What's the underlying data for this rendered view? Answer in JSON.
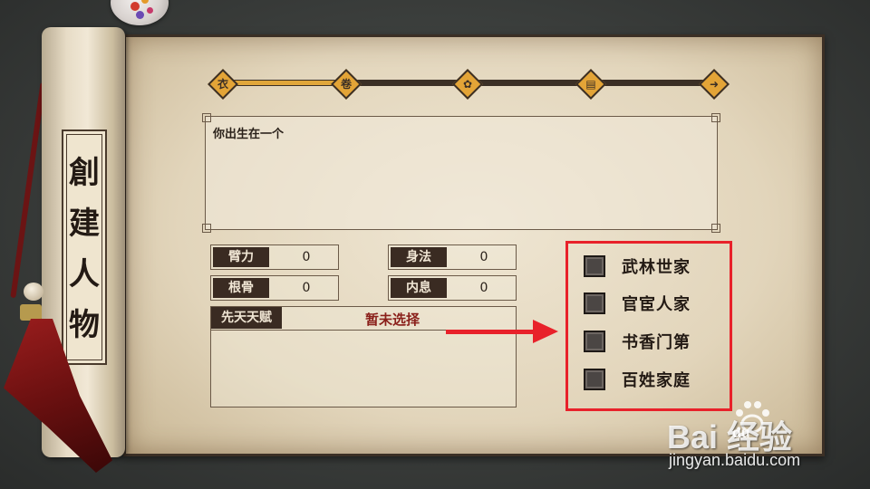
{
  "scroll": {
    "title_chars": [
      "創",
      "建",
      "人",
      "物"
    ]
  },
  "progress": {
    "steps": 5,
    "current_step": 1,
    "fill_fraction": 0.25,
    "node_icons": [
      "robe-icon",
      "scroll-icon",
      "lotus-icon",
      "book-icon",
      "arrow-right-icon"
    ],
    "node_glyphs": [
      "衣",
      "卷",
      "✿",
      "▤",
      "➜"
    ]
  },
  "description": {
    "text": "你出生在一个"
  },
  "stats": [
    {
      "label": "臂力",
      "value": "0"
    },
    {
      "label": "身法",
      "value": "0"
    },
    {
      "label": "根骨",
      "value": "0"
    },
    {
      "label": "内息",
      "value": "0"
    }
  ],
  "talent": {
    "label": "先天天赋",
    "value": "暂未选择"
  },
  "options": [
    {
      "label": "武林世家",
      "checked": false
    },
    {
      "label": "官宦人家",
      "checked": false
    },
    {
      "label": "书香门第",
      "checked": false
    },
    {
      "label": "百姓家庭",
      "checked": false
    }
  ],
  "annotation": {
    "highlight_color": "#e8212a"
  },
  "watermark": {
    "brand": "Bai  经验",
    "brand_du": "du",
    "url": "jingyan.baidu.com"
  }
}
